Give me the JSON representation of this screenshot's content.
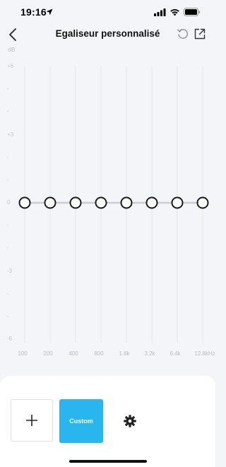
{
  "status_bar": {
    "time": "19:16",
    "icons": [
      "location-arrow-icon",
      "signal-icon",
      "wifi-icon",
      "battery-icon"
    ]
  },
  "header": {
    "title": "Egaliseur personnalisé",
    "back_icon": "chevron-left-icon",
    "reset_icon": "reset-icon",
    "export_icon": "export-icon"
  },
  "equalizer": {
    "unit": "dB",
    "y_ticks": [
      "+6",
      "-",
      "-",
      "+3",
      "-",
      "-",
      "0",
      "-",
      "-",
      "-3",
      "-",
      "-",
      "-6"
    ],
    "bands": [
      "100",
      "200",
      "400",
      "800",
      "1.6k",
      "3.2k",
      "6.4k",
      "12.8kHz"
    ],
    "gains_db": [
      0,
      0,
      0,
      0,
      0,
      0,
      0,
      0
    ],
    "range_db": [
      -6,
      6
    ]
  },
  "bottom_panel": {
    "add_icon": "plus-icon",
    "preset_label": "Custom",
    "settings_icon": "gear-icon"
  },
  "colors": {
    "background": "#f3f5f9",
    "accent": "#29b6ee",
    "slider_line": "#c9ccd2",
    "knob_border": "#1a1a1a"
  }
}
